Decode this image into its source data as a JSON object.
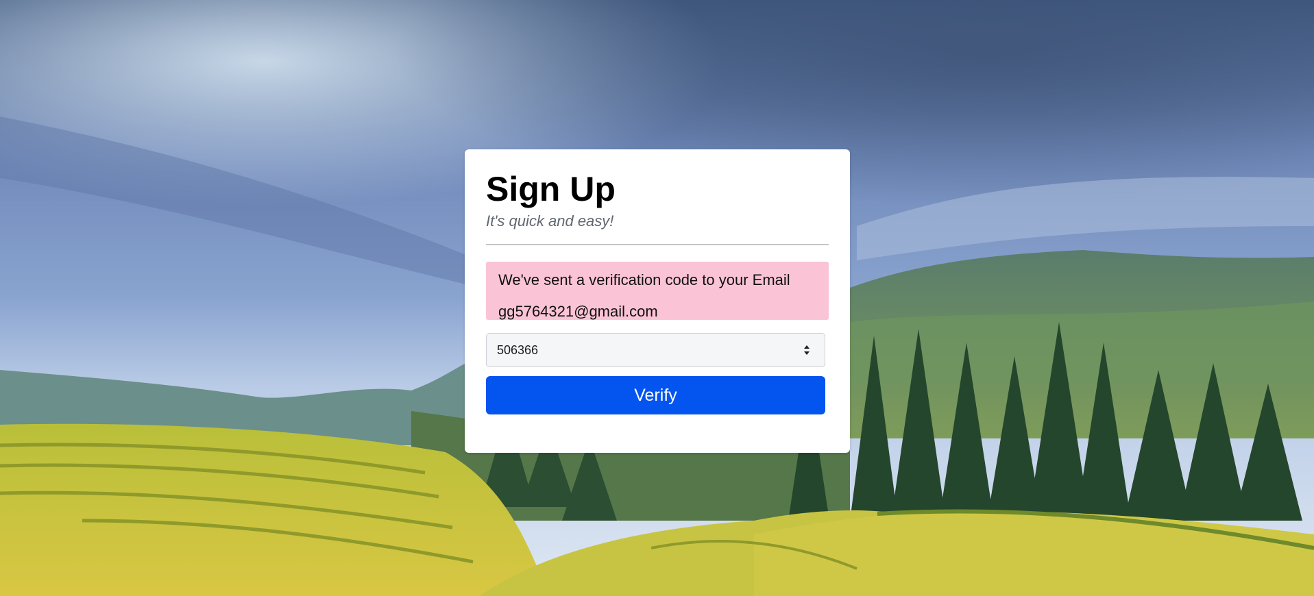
{
  "signup": {
    "title": "Sign Up",
    "subtitle": "It's quick and easy!",
    "alert": {
      "line1": "We've sent a verification code to your Email",
      "line2": "gg5764321@gmail.com"
    },
    "code_input": {
      "value": "506366",
      "type": "number"
    },
    "verify_label": "Verify"
  },
  "background": {
    "description_icon": "landscape-photo",
    "sky_color": "#6f88b8",
    "mountain_color": "#4f7a5a",
    "field_color": "#c9c43a",
    "tree_color": "#24462c"
  },
  "colors": {
    "alert_bg": "#fbc4d6",
    "button_bg": "#0455f0",
    "card_bg": "#ffffff"
  }
}
